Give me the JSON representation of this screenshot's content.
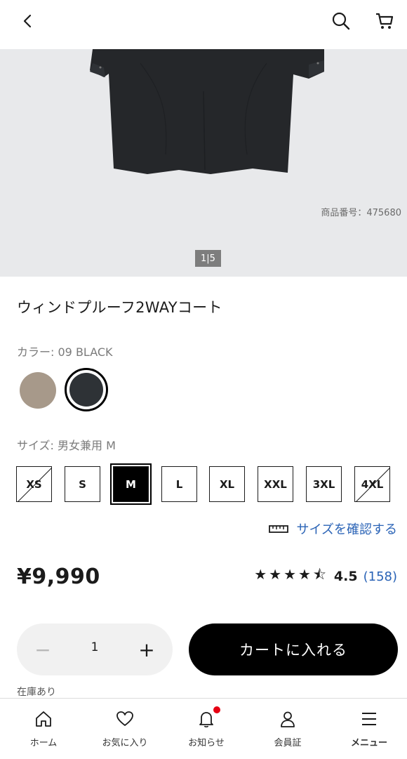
{
  "header": {
    "back_icon": "chevron-left-icon",
    "search_icon": "search-icon",
    "cart_icon": "cart-icon"
  },
  "gallery": {
    "product_number": "商品番号：475680",
    "pager": "1|5"
  },
  "product": {
    "title": "ウィンドプルーフ2WAYコート"
  },
  "color": {
    "label": "カラー:",
    "value": "09 BLACK",
    "swatches": [
      {
        "name": "beige",
        "hex": "#a7998a"
      },
      {
        "name": "black",
        "hex": "#2e3236",
        "selected": true
      }
    ]
  },
  "size": {
    "label": "サイズ:",
    "value": "男女兼用 M",
    "options": [
      {
        "label": "XS",
        "available": false
      },
      {
        "label": "S",
        "available": true
      },
      {
        "label": "M",
        "available": true,
        "selected": true
      },
      {
        "label": "L",
        "available": true
      },
      {
        "label": "XL",
        "available": true
      },
      {
        "label": "XXL",
        "available": true
      },
      {
        "label": "3XL",
        "available": true
      },
      {
        "label": "4XL",
        "available": false
      }
    ],
    "check_link": "サイズを確認する"
  },
  "price": "¥9,990",
  "rating": {
    "stars": "★★★★⯪",
    "value": "4.5",
    "count": "(158)"
  },
  "quantity": {
    "minus": "−",
    "value": "1",
    "plus": "+"
  },
  "cart_button": "カートに入れる",
  "stock": "在庫あり",
  "tabbar": {
    "items": [
      {
        "label": "ホーム",
        "icon": "home-icon"
      },
      {
        "label": "お気に入り",
        "icon": "heart-icon"
      },
      {
        "label": "お知らせ",
        "icon": "bell-icon",
        "badge": true
      },
      {
        "label": "会員証",
        "icon": "person-icon"
      },
      {
        "label": "メニュー",
        "icon": "menu-icon"
      }
    ]
  },
  "colors": {
    "link": "#2a63b6",
    "badge": "#e60012",
    "image_bg": "#e8e9eb"
  }
}
